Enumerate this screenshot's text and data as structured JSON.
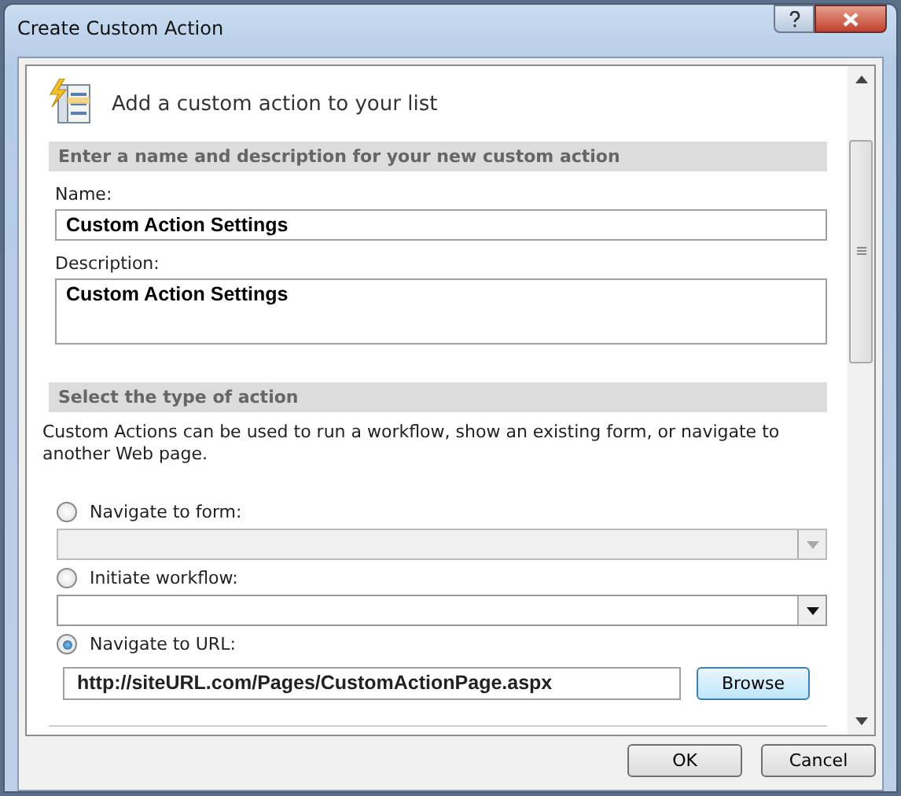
{
  "window": {
    "title": "Create Custom Action"
  },
  "header": "Add a custom action to your list",
  "sections": [
    {
      "title": "Enter a name and description for your new custom action",
      "kind": "fields"
    },
    {
      "title": "Select the type of action",
      "kind": "actions"
    }
  ],
  "fields": [
    {
      "label": "Name:",
      "value": "Custom Action Settings",
      "kind": "single"
    },
    {
      "label": "Description:",
      "value": "Custom Action Settings",
      "kind": "multi"
    }
  ],
  "actions_intro": "Custom Actions can be used to run a workflow, show an existing form, or navigate to another Web page.",
  "actions": [
    {
      "label": "Navigate to form:",
      "selected": false,
      "kind": "dropdown",
      "disabled": true
    },
    {
      "label": "Initiate workflow:",
      "selected": false,
      "kind": "dropdown",
      "disabled": false
    },
    {
      "label": "Navigate to URL:",
      "selected": true,
      "kind": "url",
      "value": "http://siteURL.com/Pages/CustomActionPage.aspx",
      "button": "Browse"
    }
  ],
  "buttons": [
    "OK",
    "Cancel"
  ]
}
